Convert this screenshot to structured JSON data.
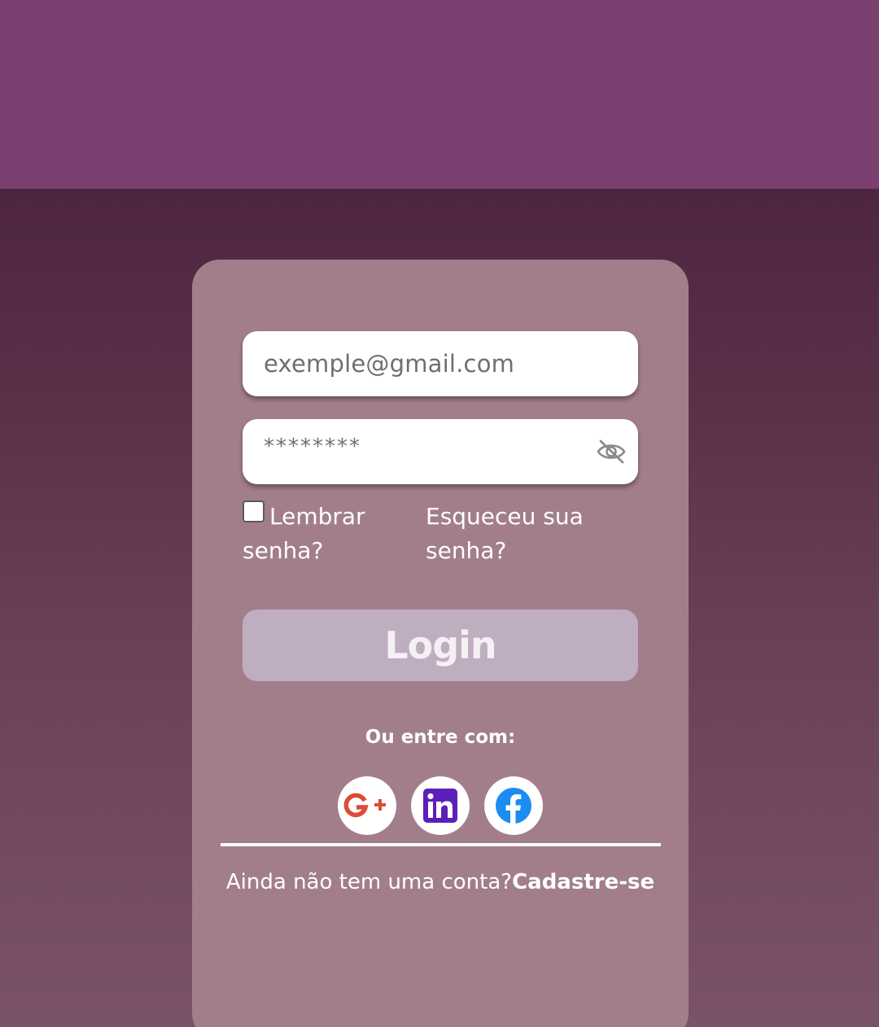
{
  "colors": {
    "top_bar": "#7a3f6e",
    "card": "#a27e8b",
    "login_button": "#bfaebf"
  },
  "login_form": {
    "email_placeholder": "exemple@gmail.com",
    "password_value": "********",
    "password_toggle_icon": "eye-off-icon",
    "remember_label": "Lembrar senha?",
    "remember_checked": false,
    "forgot_link": "Esqueceu sua senha?",
    "login_button": "Login"
  },
  "social_login": {
    "label": "Ou entre com:",
    "providers": [
      "google-plus-icon",
      "linkedin-icon",
      "facebook-icon"
    ]
  },
  "signup": {
    "prompt": "Ainda não tem uma conta?",
    "link": "Cadastre-se"
  }
}
